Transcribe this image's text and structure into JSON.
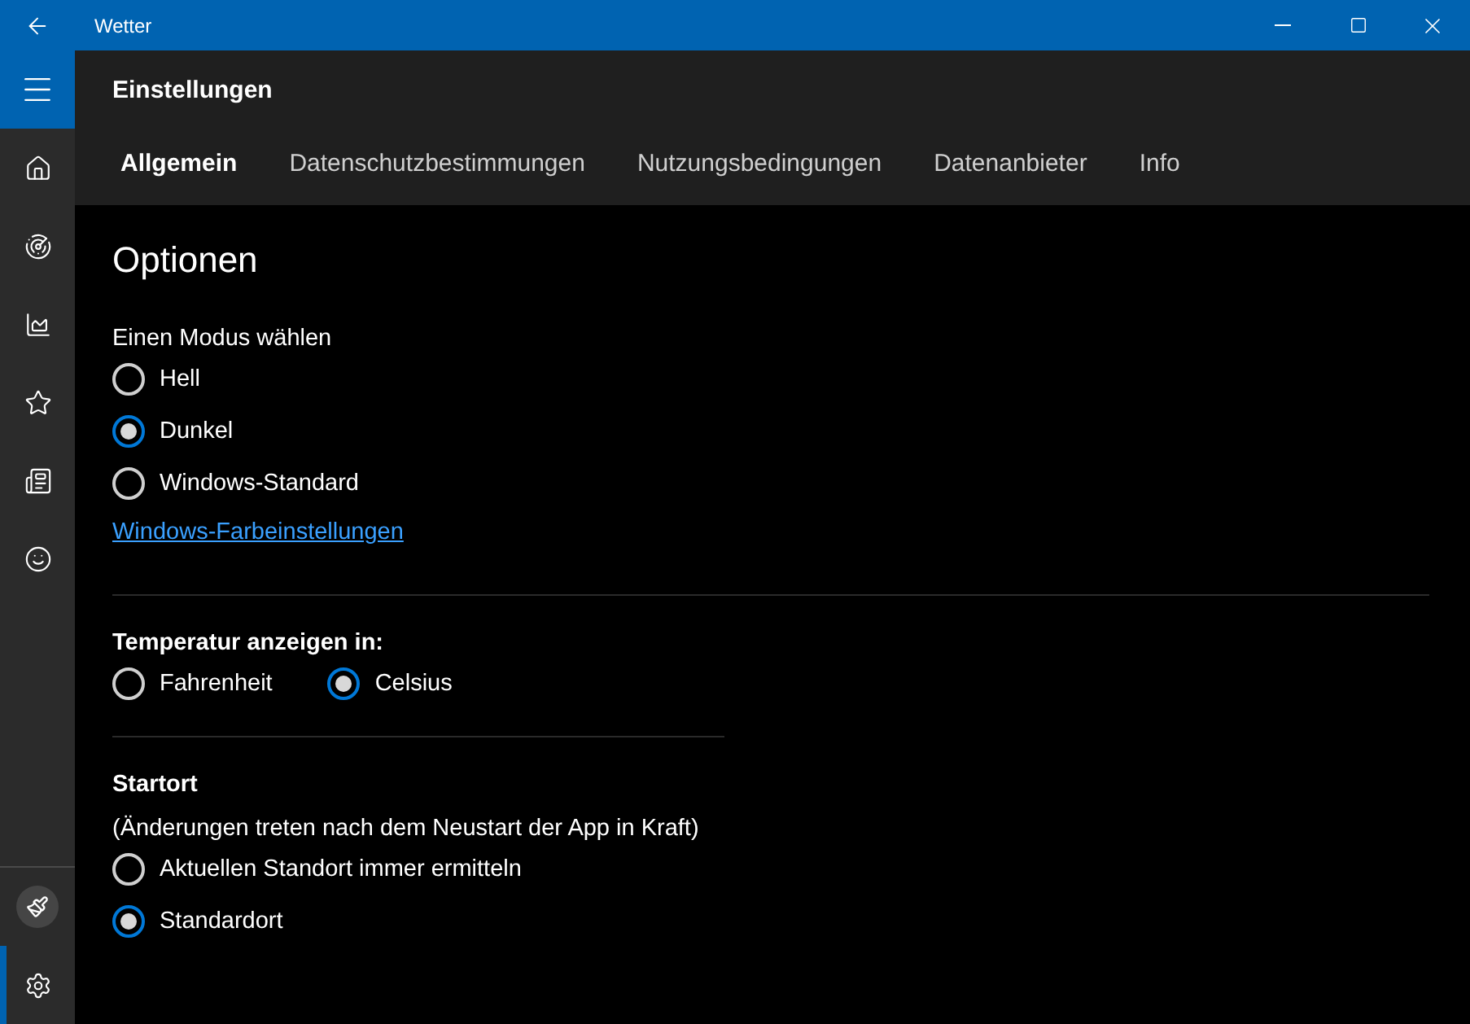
{
  "window": {
    "title": "Wetter"
  },
  "sidebar": {
    "top": [
      {
        "kind": "home",
        "selected": false
      },
      {
        "kind": "radar",
        "selected": false
      },
      {
        "kind": "chart",
        "selected": false
      },
      {
        "kind": "favorites",
        "selected": false
      },
      {
        "kind": "news",
        "selected": false
      },
      {
        "kind": "feedback",
        "selected": false
      }
    ],
    "bottom": [
      {
        "kind": "brush",
        "selected": false
      },
      {
        "kind": "settings",
        "selected": true
      }
    ]
  },
  "header": {
    "title": "Einstellungen",
    "tabs": [
      {
        "label": "Allgemein",
        "selected": true
      },
      {
        "label": "Datenschutzbestimmungen",
        "selected": false
      },
      {
        "label": "Nutzungsbedingungen",
        "selected": false
      },
      {
        "label": "Datenanbieter",
        "selected": false
      },
      {
        "label": "Info",
        "selected": false
      }
    ]
  },
  "options": {
    "heading": "Optionen",
    "mode": {
      "label": "Einen Modus wählen",
      "choices": [
        {
          "label": "Hell",
          "selected": false
        },
        {
          "label": "Dunkel",
          "selected": true
        },
        {
          "label": "Windows-Standard",
          "selected": false
        }
      ],
      "link": "Windows-Farbeinstellungen"
    },
    "temperature": {
      "label": "Temperatur anzeigen in:",
      "choices": [
        {
          "label": "Fahrenheit",
          "selected": false
        },
        {
          "label": "Celsius",
          "selected": true
        }
      ]
    },
    "start": {
      "label": "Startort",
      "note": "(Änderungen treten nach dem Neustart der App in Kraft)",
      "choices": [
        {
          "label": "Aktuellen Standort immer ermitteln",
          "selected": false
        },
        {
          "label": "Standardort",
          "selected": true
        }
      ]
    }
  }
}
